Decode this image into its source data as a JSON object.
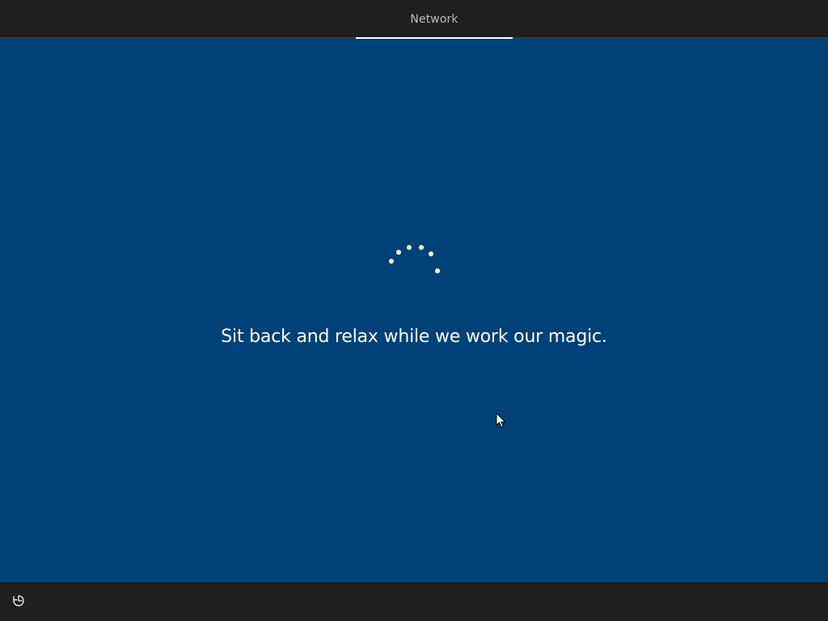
{
  "header": {
    "tabs": [
      {
        "label": "Network",
        "active": true
      }
    ]
  },
  "main": {
    "message": "Sit back and relax while we work our magic."
  },
  "footer": {
    "ease_of_access_icon": "ease-of-access-icon"
  },
  "colors": {
    "background": "#004275",
    "bar": "#1f1f1f",
    "text": "#ffffff",
    "tab_text": "#bdbdbd"
  }
}
